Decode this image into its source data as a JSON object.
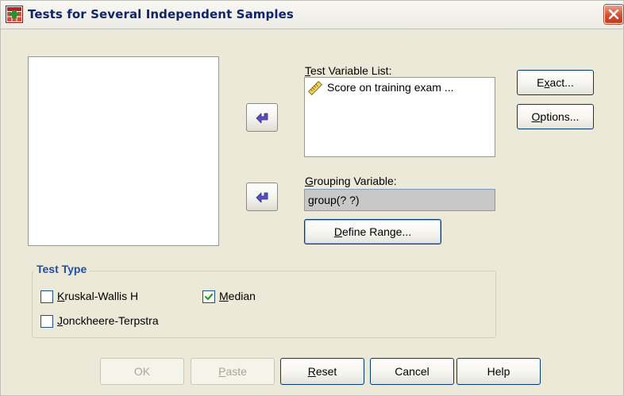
{
  "window": {
    "title": "Tests for Several Independent Samples"
  },
  "icons": {
    "app": "spss-dialog-icon",
    "close": "close-icon",
    "arrow": "move-arrow-icon",
    "variable": "ruler-icon",
    "check": "checkmark-icon"
  },
  "colors": {
    "title_text": "#10246a",
    "close_button": "#d4502f",
    "legend_text": "#1f4fa8",
    "dialog_bg": "#ece9d8",
    "arrow_icon": "#5a4ec0"
  },
  "test_variable": {
    "label_mnemonic": "T",
    "label_rest": "est Variable List:",
    "items": [
      {
        "name": "Score on training exam ..."
      }
    ]
  },
  "grouping_variable": {
    "label_mnemonic": "G",
    "label_rest": "rouping Variable:",
    "value": "group(? ?)"
  },
  "define_range": {
    "mnemonic": "D",
    "rest": "efine Range..."
  },
  "side_buttons": {
    "exact": {
      "pre": "E",
      "mnemonic": "x",
      "rest": "act..."
    },
    "options": {
      "mnemonic": "O",
      "rest": "ptions..."
    }
  },
  "test_type": {
    "legend": "Test Type",
    "kruskal": {
      "mnemonic": "K",
      "rest": "ruskal-Wallis H",
      "checked": false
    },
    "median": {
      "mnemonic": "M",
      "rest": "edian",
      "checked": true
    },
    "jonckheere": {
      "mnemonic": "J",
      "rest": "onckheere-Terpstra",
      "checked": false
    }
  },
  "footer": {
    "ok": "OK",
    "paste": {
      "mnemonic": "P",
      "rest": "aste"
    },
    "reset": {
      "mnemonic": "R",
      "rest": "eset"
    },
    "cancel": "Cancel",
    "help": "Help"
  }
}
